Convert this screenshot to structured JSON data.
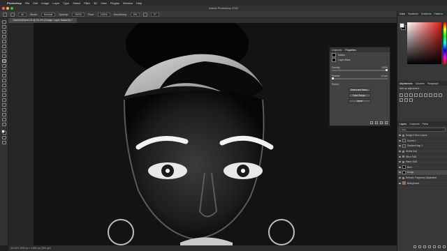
{
  "menubar": {
    "app": "Photoshop",
    "items": [
      "File",
      "Edit",
      "Image",
      "Layer",
      "Type",
      "Select",
      "Filter",
      "3D",
      "View",
      "Plugins",
      "Window",
      "Help"
    ]
  },
  "titlebar": {
    "title": "Adobe Photoshop 2022"
  },
  "optbar": {
    "size": "40",
    "mode_label": "Mode:",
    "mode": "Normal",
    "opacity_label": "Opacity:",
    "opacity": "100%",
    "flow_label": "Flow:",
    "flow": "100%",
    "smoothing_label": "Smoothing:",
    "smoothing": "0%",
    "angle": "0°"
  },
  "document": {
    "tab": "TrackGirlEyes1.tif @ 33.3% (Dodge, Layer Mask/16) *",
    "status": "33.33%   2000 px x 1600 px (300 ppi)"
  },
  "properties": {
    "tabs": [
      "Channels",
      "Properties"
    ],
    "section": "Masks",
    "mask_label": "Layer Mask",
    "density_label": "Density:",
    "density": "100%",
    "density_level": 1.0,
    "feather_label": "Feather:",
    "feather": "0.0 px",
    "feather_level": 0.0,
    "refine_label": "Refine:",
    "buttons": [
      "Select and Mask...",
      "Color Range...",
      "Invert"
    ]
  },
  "right": {
    "color_tabs": [
      "Color",
      "Swatches",
      "Gradients",
      "Patterns"
    ],
    "adj_tabs": [
      "Adjustments",
      "Libraries",
      "Paragraph"
    ],
    "adj_title": "Add an adjustment",
    "layers_tabs": [
      "Layers",
      "Channels",
      "Paths"
    ],
    "layer_filter": "Kind",
    "layers": [
      {
        "name": "Dodge & Burn Layers",
        "type": "group"
      },
      {
        "name": "Curves 1",
        "type": "adj"
      },
      {
        "name": "Gradient Map 1",
        "type": "adj"
      },
      {
        "name": "Global Soft",
        "type": "group"
      },
      {
        "name": "Micro D&B",
        "type": "group"
      },
      {
        "name": "Macro D&B",
        "type": "group"
      },
      {
        "name": "Burn",
        "type": "mask"
      },
      {
        "name": "Dodge",
        "type": "mask"
      },
      {
        "name": "Retouch Frequency Separation",
        "type": "group"
      },
      {
        "name": "Background",
        "type": "image"
      }
    ]
  },
  "colors": {
    "accent": "#e01a1a",
    "panel": "#383838"
  }
}
